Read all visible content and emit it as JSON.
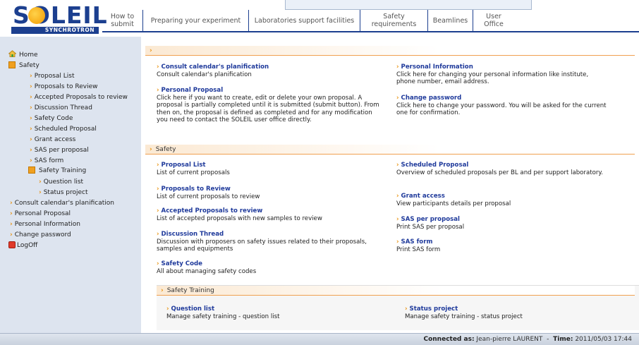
{
  "header": {
    "logo_word": "SOLEIL",
    "logo_sub": "SYNCHROTRON",
    "nav": [
      {
        "label": "How to submit"
      },
      {
        "label": "Preparing your experiment"
      },
      {
        "label": "Laboratories support facilities"
      },
      {
        "label": "Safety requirements"
      },
      {
        "label": "Beamlines"
      },
      {
        "label": "User Office"
      }
    ]
  },
  "sidebar": {
    "items": [
      {
        "label": "Home",
        "icon": "home-icon"
      },
      {
        "label": "Safety",
        "icon": "folder-icon"
      },
      {
        "label": "Proposal List"
      },
      {
        "label": "Proposals to Review"
      },
      {
        "label": "Accepted Proposals to review"
      },
      {
        "label": "Discussion Thread"
      },
      {
        "label": "Safety Code"
      },
      {
        "label": "Scheduled Proposal"
      },
      {
        "label": "Grant access"
      },
      {
        "label": "SAS per proposal"
      },
      {
        "label": "SAS form"
      },
      {
        "label": "Safety Training",
        "icon": "folder-icon"
      },
      {
        "label": "Question list"
      },
      {
        "label": "Status project"
      },
      {
        "label": "Consult calendar's planification"
      },
      {
        "label": "Personal Proposal"
      },
      {
        "label": "Personal Information"
      },
      {
        "label": "Change password"
      },
      {
        "label": "LogOff",
        "icon": "logoff-icon"
      }
    ]
  },
  "main": {
    "top_section": {
      "label": "",
      "left": [
        {
          "title": "Consult calendar's planification",
          "desc": "Consult calendar's planification"
        },
        {
          "title": "Personal Proposal",
          "desc": "Click here if you want to create, edit or delete your own proposal. A proposal is partially completed until it is submitted (submit button). From then on, the proposal is defined as completed and for any modification you need to contact the SOLEIL user office directly."
        }
      ],
      "right": [
        {
          "title": "Personal Information",
          "desc": "Click here for changing your personal information like institute, phone number, email address."
        },
        {
          "title": "Change password",
          "desc": "Click here to change your password. You will be asked for the current one for confirmation."
        }
      ]
    },
    "safety_section": {
      "label": "Safety",
      "left": [
        {
          "title": "Proposal List",
          "desc": "List of current proposals"
        },
        {
          "title": "Proposals to Review",
          "desc": "List of current proposals to review"
        },
        {
          "title": "Accepted Proposals to review",
          "desc": "List of accepted proposals with new samples to review"
        },
        {
          "title": "Discussion Thread",
          "desc": "Discussion with proposers on safety issues related to their proposals, samples and equipments"
        },
        {
          "title": "Safety Code",
          "desc": "All about managing safety codes"
        }
      ],
      "right": [
        {
          "title": "Scheduled Proposal",
          "desc": "Overview of scheduled proposals per BL and per support laboratory."
        },
        {
          "title": "Grant access",
          "desc": "View participants details per proposal"
        },
        {
          "title": "SAS per proposal",
          "desc": "Print SAS per proposal"
        },
        {
          "title": "SAS form",
          "desc": "Print SAS form"
        }
      ]
    },
    "training_section": {
      "label": "Safety Training",
      "left": [
        {
          "title": "Question list",
          "desc": "Manage safety training - question list"
        }
      ],
      "right": [
        {
          "title": "Status project",
          "desc": "Manage safety training - status project"
        }
      ]
    }
  },
  "footer": {
    "connected_label": "Connected as:",
    "connected_user": "Jean-pierre LAURENT",
    "separator": "-",
    "time_label": "Time:",
    "time_value": "2011/05/03 17:44"
  },
  "colors": {
    "brand_blue": "#1c3f8f",
    "accent_orange": "#e8900a",
    "link_blue": "#1f3a9b",
    "sidebar_bg": "#dde4ef"
  }
}
